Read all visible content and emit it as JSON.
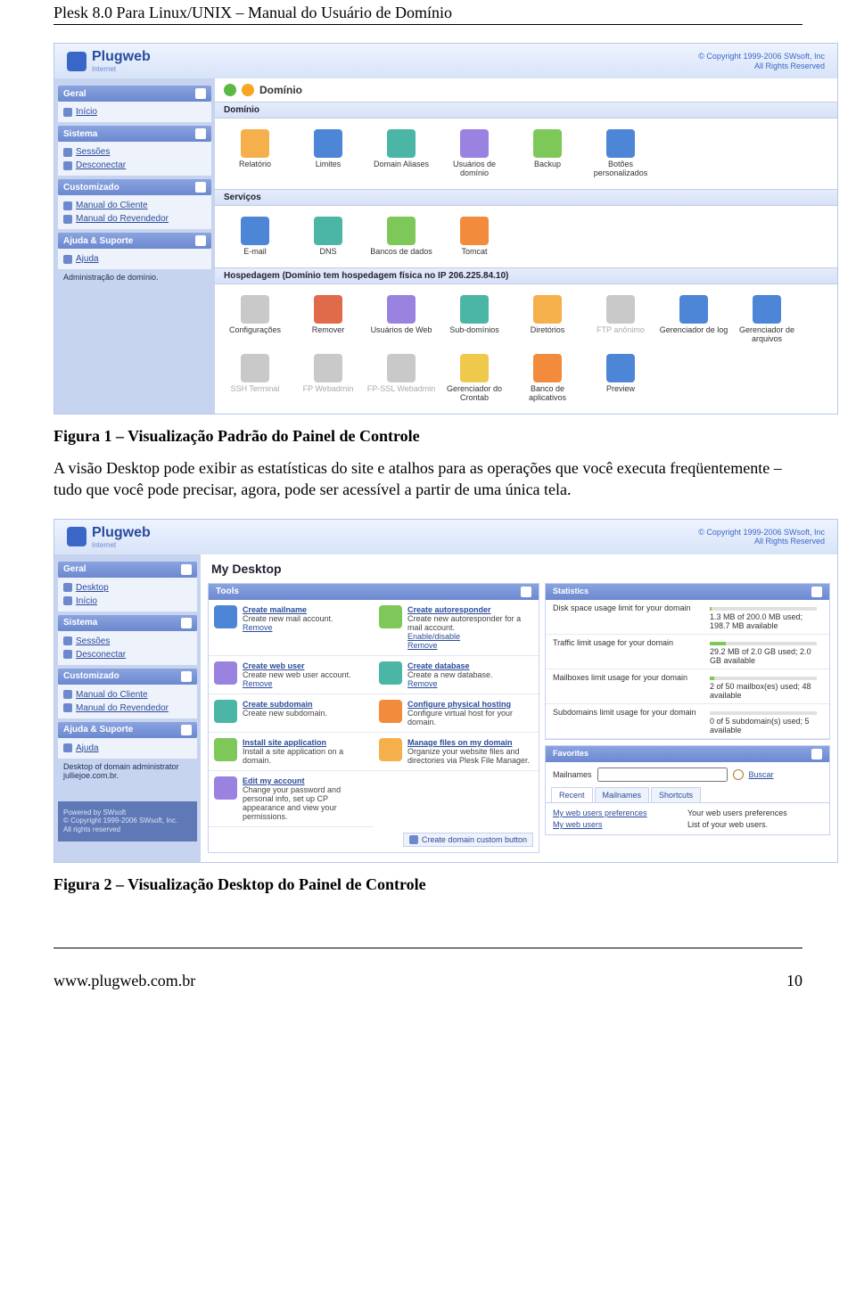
{
  "doc": {
    "header": "Plesk 8.0 Para Linux/UNIX – Manual do Usuário de Domínio",
    "caption1": "Figura 1 – Visualização Padrão do Painel de Controle",
    "paragraph": "A visão Desktop pode exibir as estatísticas do site e atalhos para as operações que você executa freqüentemente – tudo que você pode precisar, agora, pode ser acessível a partir de uma única tela.",
    "caption2": "Figura 2 – Visualização Desktop do Painel de Controle",
    "footer_left": "www.plugweb.com.br",
    "footer_right": "10"
  },
  "banner": {
    "brand": "Plugweb",
    "brand_sub": "Internet",
    "copyright_l1": "© Copyright 1999-2006 SWsoft, Inc",
    "copyright_l2": "All Rights Reserved"
  },
  "fig1": {
    "crumb": "Domínio",
    "sections": {
      "dominio": "Domínio",
      "servicos": "Serviços",
      "hospedagem": "Hospedagem (Domínio tem hospedagem física no IP 206.225.84.10)"
    },
    "sidebar": {
      "cats": [
        "Geral",
        "Sistema",
        "Customizado",
        "Ajuda & Suporte"
      ],
      "geral": [
        "Início"
      ],
      "sistema": [
        "Sessões",
        "Desconectar"
      ],
      "custom": [
        "Manual do Cliente",
        "Manual do Revendedor"
      ],
      "ajuda": [
        "Ajuda"
      ],
      "help_text": "Administração de domínio."
    },
    "row1": [
      "Relatório",
      "Limites",
      "Domain Aliases",
      "Usuários de domínio",
      "Backup",
      "Botões personalizados"
    ],
    "row2": [
      "E-mail",
      "DNS",
      "Bancos de dados",
      "Tomcat"
    ],
    "row3": [
      "Configurações",
      "Remover",
      "Usuários de Web",
      "Sub-domínios",
      "Diretórios",
      "FTP anônimo",
      "Gerenciador de log",
      "Gerenciador de arquivos",
      "SSH Terminal"
    ],
    "row4": [
      "FP Webadmin",
      "FP-SSL Webadmin",
      "Gerenciador do Crontab",
      "Banco de aplicativos",
      "Preview"
    ]
  },
  "fig2": {
    "desktop_title": "My Desktop",
    "sidebar": {
      "cats": [
        "Geral",
        "Sistema",
        "Customizado",
        "Ajuda & Suporte"
      ],
      "geral": [
        "Desktop",
        "Início"
      ],
      "sistema": [
        "Sessões",
        "Desconectar"
      ],
      "custom": [
        "Manual do Cliente",
        "Manual do Revendedor"
      ],
      "ajuda": [
        "Ajuda"
      ],
      "help_text": "Desktop of domain administrator julliejoe.com.br."
    },
    "tools_title": "Tools",
    "tools": [
      {
        "t": "Create mailname",
        "d": "Create new mail account.",
        "l": "Remove"
      },
      {
        "t": "Create autoresponder",
        "d": "Create new autoresponder for a mail account.",
        "l": "Enable/disable",
        "l2": "Remove"
      },
      {
        "t": "Create web user",
        "d": "Create new web user account.",
        "l": "Remove"
      },
      {
        "t": "Create database",
        "d": "Create a new database.",
        "l": "Remove"
      },
      {
        "t": "Create subdomain",
        "d": "Create new subdomain."
      },
      {
        "t": "Configure physical hosting",
        "d": "Configure virtual host for your domain."
      },
      {
        "t": "Install site application",
        "d": "Install a site application on a domain."
      },
      {
        "t": "Manage files on my domain",
        "d": "Organize your website files and directories via Plesk File Manager."
      },
      {
        "t": "Edit my account",
        "d": "Change your password and personal info, set up CP appearance and view your permissions."
      }
    ],
    "create_btn": "Create domain custom button",
    "stats_title": "Statistics",
    "stats": [
      {
        "k": "Disk space usage limit for your domain",
        "v": "1.3 MB of 200.0 MB used; 198.7 MB available",
        "b": "p1"
      },
      {
        "k": "Traffic limit usage for your domain",
        "v": "29.2 MB of 2.0 GB used; 2.0 GB available",
        "b": "p15"
      },
      {
        "k": "Mailboxes limit usage for your domain",
        "v": "2 of 50 mailbox(es) used; 48 available",
        "b": "p4"
      },
      {
        "k": "Subdomains limit usage for your domain",
        "v": "0 of 5 subdomain(s) used; 5 available",
        "b": "p0"
      }
    ],
    "fav_title": "Favorites",
    "fav_label": "Mailnames",
    "fav_search": "Buscar",
    "fav_tabs": [
      "Recent",
      "Mailnames",
      "Shortcuts"
    ],
    "fav_links": [
      {
        "a": "My web users preferences",
        "b": "Your web users preferences"
      },
      {
        "a": "My web users",
        "b": "List of your web users."
      }
    ],
    "sidefoot_l1": "Powered by SWsoft",
    "sidefoot_l2": "© Copyright 1999-2006 SWsoft, Inc.",
    "sidefoot_l3": "All rights reserved"
  }
}
